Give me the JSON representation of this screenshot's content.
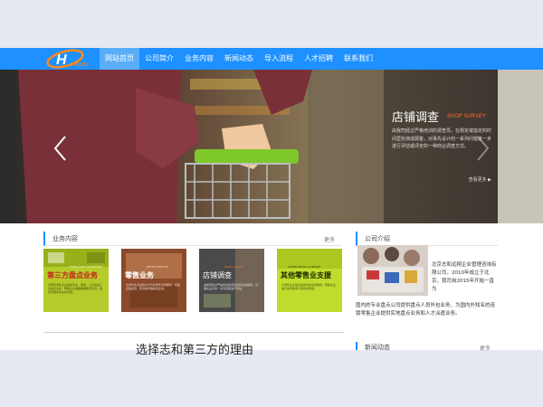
{
  "nav": {
    "logo_text": "H",
    "items": [
      {
        "label": "网站首页",
        "active": true
      },
      {
        "label": "公司简介"
      },
      {
        "label": "业务内容"
      },
      {
        "label": "新闻动态"
      },
      {
        "label": "导入流程"
      },
      {
        "label": "人才招聘"
      },
      {
        "label": "联系我们"
      }
    ]
  },
  "hero": {
    "title": "店铺调查",
    "title_en": "SHOP SURVEY",
    "description": "由我司经过严格培训的调查员，在规定或指定的时间里扮演成顾客，对事先设计的一系列问题进一步进行评估或评定的一种商业调查方式。",
    "more": "查看更多 ▶"
  },
  "services": {
    "title": "业务内容",
    "more": "更多",
    "cards": [
      {
        "title": "第三方盘点业务",
        "sub": "THIRD PARTY INVENTORY",
        "text": "为所有零售企业提供专业、客观、公正的第三方盘点业务，帮助企业准确把握库存情况，发现管理中存在的问题。"
      },
      {
        "title": "零售业务",
        "sub": "RETAIL SERVICE",
        "text": "为零售企业提供全方位的零售支援服务，包括店铺运营、陈列指导等各项业务。"
      },
      {
        "title": "店铺调查",
        "sub": "SHOP SURVEY",
        "text": "由我司经过严格培训的调查员扮演成顾客，对事先设计的一系列问题进行评估。"
      },
      {
        "title": "其他零售业支援",
        "sub": "OTHER RETAIL SUPPORT",
        "text": "为零售企业提供多样化的支援服务，帮助企业提升运营效率与顾客满意度。"
      }
    ]
  },
  "company": {
    "title": "公司介绍",
    "text_1": "北京志和远翔企业管理咨询有限公司，2010年成立于北京，我司自2015年开始一直为",
    "text_2": "国内的专业盘点公司提供盘点人员外包业务，为国内外知名的连锁零售企业提供实地盘点业务和人才派遣业务。"
  },
  "news": {
    "title": "新闻动态",
    "more": "更多"
  },
  "why": {
    "title": "选择志和第三方的理由"
  },
  "colors": {
    "brand": "#1e90ff",
    "card_green": "#b5cb2a",
    "accent_orange": "#ff6a2a"
  }
}
